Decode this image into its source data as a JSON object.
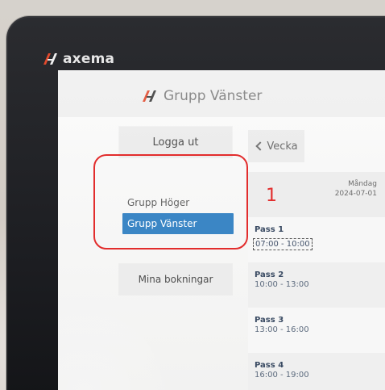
{
  "device": {
    "brand": "axema"
  },
  "header": {
    "title": "Grupp Vänster"
  },
  "left_panel": {
    "logout_label": "Logga ut",
    "groups": [
      {
        "label": "Grupp Höger",
        "state": "inactive"
      },
      {
        "label": "Grupp Vänster",
        "state": "active"
      }
    ],
    "bookings_label": "Mina bokningar"
  },
  "annotation": {
    "number": "1",
    "color": "#e22d2d"
  },
  "calendar": {
    "week_button_label": "Vecka",
    "day_name": "Måndag",
    "day_date": "2024-07-01",
    "slots": [
      {
        "title": "Pass 1",
        "time": "07:00 - 10:00",
        "focused": true
      },
      {
        "title": "Pass 2",
        "time": "10:00 - 13:00",
        "focused": false
      },
      {
        "title": "Pass 3",
        "time": "13:00 - 16:00",
        "focused": false
      },
      {
        "title": "Pass 4",
        "time": "16:00 - 19:00",
        "focused": false
      }
    ]
  },
  "colors": {
    "accent": "#3b86c5",
    "annotation": "#e22d2d",
    "brand": "#e24a2d"
  },
  "icons": {
    "brand_logo": "axema-logo-icon",
    "back": "chevron-left-icon"
  }
}
